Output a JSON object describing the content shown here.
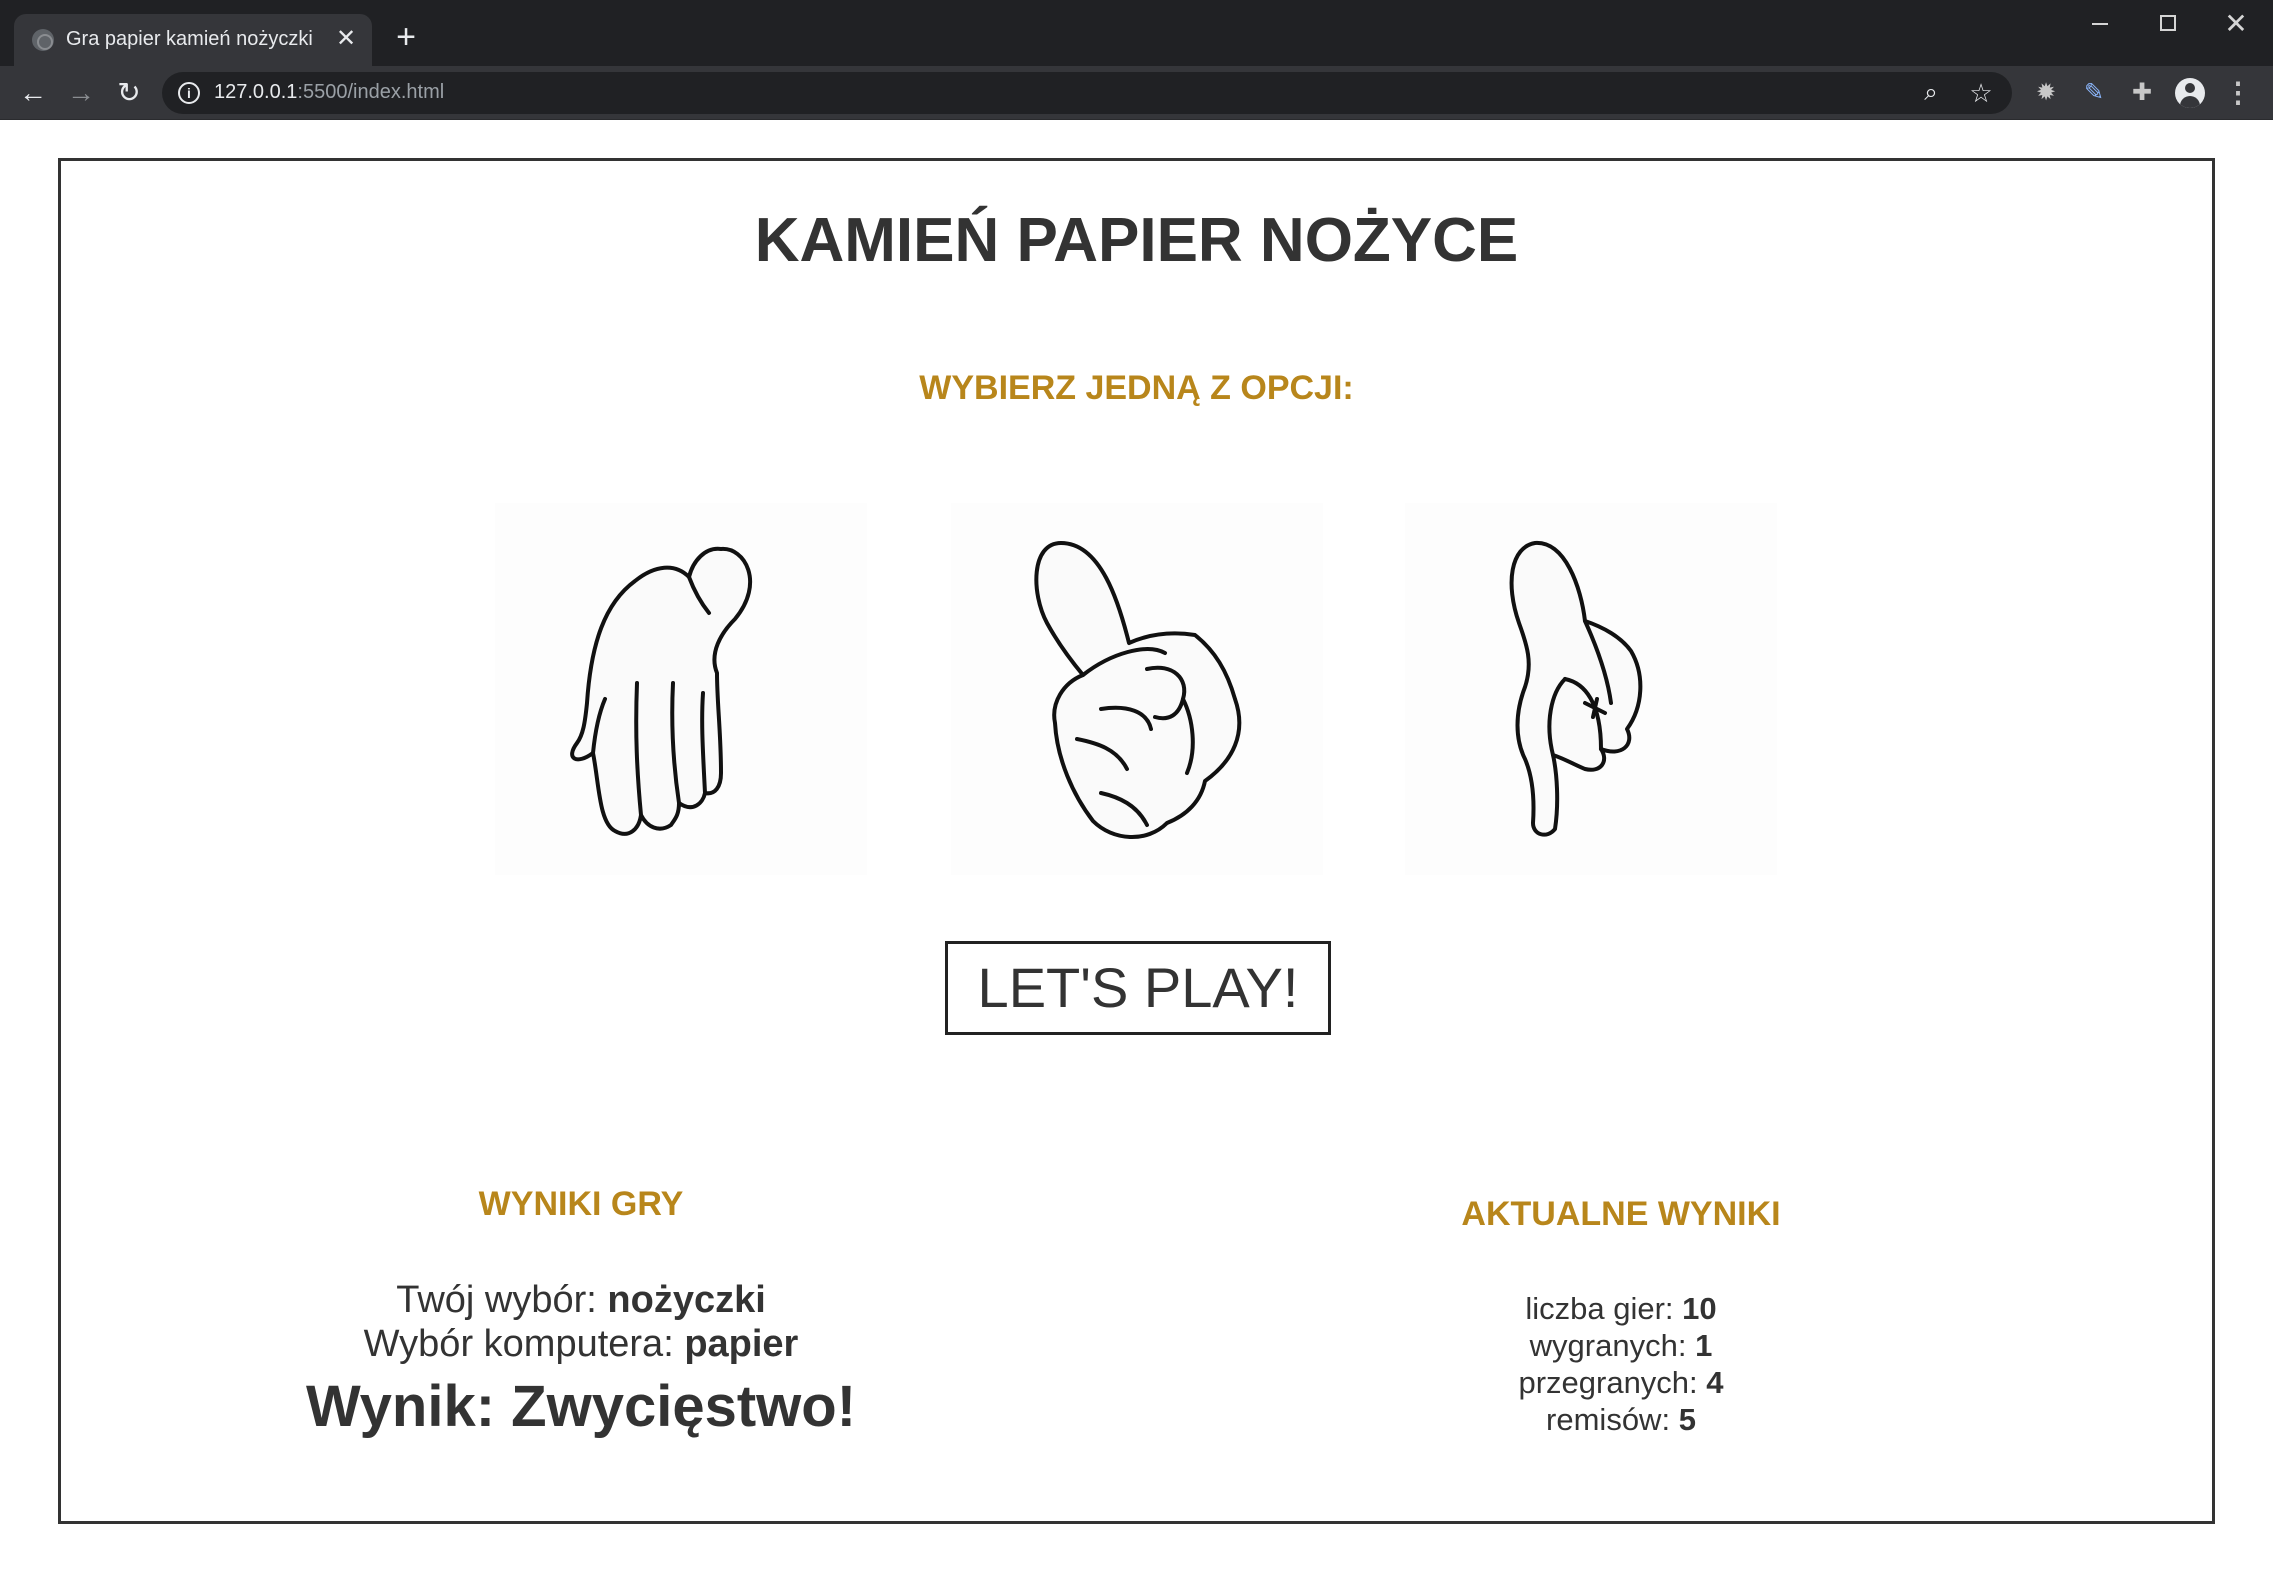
{
  "browser": {
    "tab_title": "Gra papier kamień nożyczki",
    "url_host": "127.0.0.1",
    "url_path": ":5500/index.html"
  },
  "page": {
    "title": "KAMIEŃ PAPIER NOŻYCE",
    "choose_prompt": "WYBIERZ JEDNĄ Z OPCJI:",
    "options": [
      "papier",
      "kamień",
      "nożyczki"
    ],
    "play_button": "LET'S PLAY!",
    "game_results": {
      "heading": "WYNIKI GRY",
      "your_choice_label": "Twój wybór:",
      "your_choice_value": "nożyczki",
      "computer_choice_label": "Wybór komputera:",
      "computer_choice_value": "papier",
      "result_label": "Wynik:",
      "result_value": "Zwycięstwo!"
    },
    "stats": {
      "heading": "AKTUALNE WYNIKI",
      "games_label": "liczba gier:",
      "games_value": "10",
      "wins_label": "wygranych:",
      "wins_value": "1",
      "losses_label": "przegranych:",
      "losses_value": "4",
      "draws_label": "remisów:",
      "draws_value": "5"
    }
  },
  "colors": {
    "accent": "#b8861b",
    "text": "#333333",
    "chrome_dark": "#202124",
    "chrome_mid": "#35363a"
  },
  "icons": [
    "globe-icon",
    "close-icon",
    "plus-icon",
    "back-arrow-icon",
    "forward-arrow-icon",
    "reload-icon",
    "info-icon",
    "zoom-icon",
    "star-icon",
    "gear-icon",
    "pen-icon",
    "puzzle-icon",
    "avatar-icon",
    "kebab-menu-icon"
  ]
}
